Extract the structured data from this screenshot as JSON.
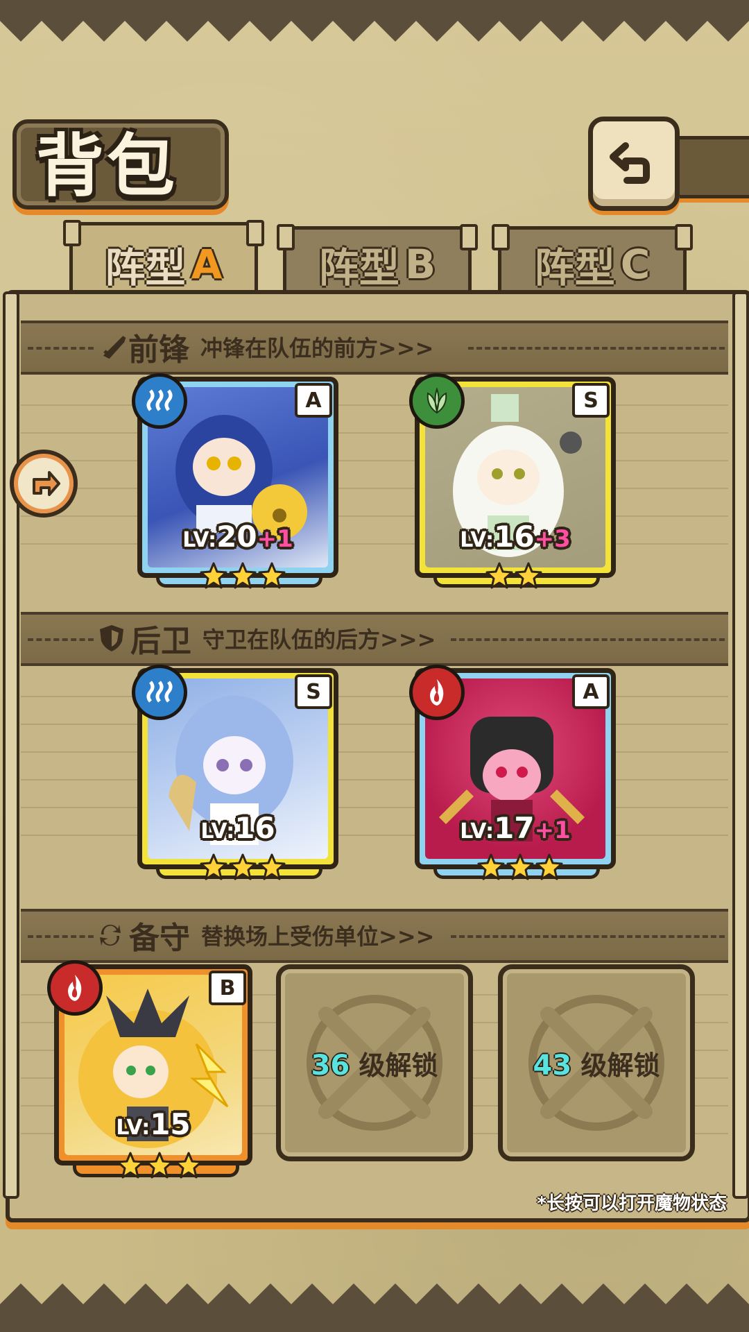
{
  "header": {
    "title": "背包"
  },
  "tabs": [
    {
      "prefix": "阵型",
      "letter": "A",
      "active": true
    },
    {
      "prefix": "阵型",
      "letter": "B",
      "active": false
    },
    {
      "prefix": "阵型",
      "letter": "C",
      "active": false
    }
  ],
  "sections": {
    "front": {
      "label": "前锋",
      "desc": "冲锋在队伍的前方>>>"
    },
    "back": {
      "label": "后卫",
      "desc": "守卫在队伍的后方>>>"
    },
    "reserve": {
      "label": "备守",
      "desc": "替换场上受伤单位>>>"
    }
  },
  "cards": [
    {
      "rank": "A",
      "lv_prefix": "LV:",
      "level": "20",
      "bonus": "+1",
      "element": "water",
      "stars": 3
    },
    {
      "rank": "S",
      "lv_prefix": "LV:",
      "level": "16",
      "bonus": "+3",
      "element": "grass",
      "stars": 2
    },
    {
      "rank": "S",
      "lv_prefix": "LV:",
      "level": "16",
      "bonus": "",
      "element": "water",
      "stars": 3
    },
    {
      "rank": "A",
      "lv_prefix": "LV:",
      "level": "17",
      "bonus": "+1",
      "element": "fire",
      "stars": 3
    },
    {
      "rank": "B",
      "lv_prefix": "LV:",
      "level": "15",
      "bonus": "",
      "element": "fire",
      "stars": 3
    }
  ],
  "locked_slots": [
    {
      "level": "36",
      "text": "级解锁"
    },
    {
      "level": "43",
      "text": "级解锁"
    }
  ],
  "hint": "*长按可以打开魔物状态",
  "colors": {
    "accent_orange": "#e48a2a",
    "rank_a_frame": "#8fd3f0",
    "rank_s_frame": "#f2e23a",
    "rank_b_frame": "#f0902a",
    "plus_pink": "#ff4fa3",
    "unlock_cyan": "#58e3e0"
  }
}
